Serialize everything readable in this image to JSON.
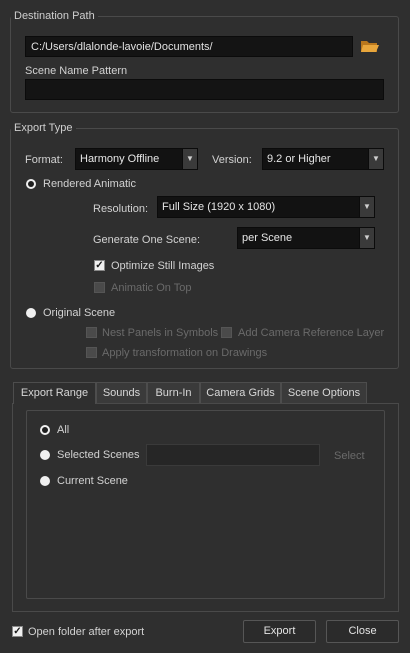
{
  "destination": {
    "title": "Destination Path",
    "path_value": "C:/Users/dlalonde-lavoie/Documents/",
    "browse_icon": "folder-icon",
    "scene_name_label": "Scene Name Pattern",
    "scene_name_value": ""
  },
  "export_type": {
    "title": "Export Type",
    "format_label": "Format:",
    "format_value": "Harmony Offline",
    "version_label": "Version:",
    "version_value": "9.2 or Higher",
    "rendered_animatic_label": "Rendered Animatic",
    "rendered_animatic_selected": true,
    "resolution_label": "Resolution:",
    "resolution_value": "Full Size (1920 x 1080)",
    "generate_scene_label": "Generate One Scene:",
    "generate_scene_value": "per Scene",
    "optimize_still_label": "Optimize Still Images",
    "optimize_still_checked": true,
    "animatic_on_top_label": "Animatic On Top",
    "animatic_on_top_checked": false,
    "original_scene_label": "Original Scene",
    "original_scene_selected": false,
    "nest_panels_label": "Nest Panels in Symbols",
    "add_camera_ref_label": "Add Camera Reference Layer",
    "apply_transform_label": "Apply transformation on Drawings"
  },
  "tabs": [
    {
      "label": "Export Range",
      "active": true
    },
    {
      "label": "Sounds",
      "active": false
    },
    {
      "label": "Burn-In",
      "active": false
    },
    {
      "label": "Camera Grids",
      "active": false
    },
    {
      "label": "Scene Options",
      "active": false
    }
  ],
  "export_range": {
    "all_label": "All",
    "all_selected": true,
    "selected_scenes_label": "Selected Scenes",
    "selected_scenes_value": "",
    "select_button_label": "Select",
    "current_scene_label": "Current Scene"
  },
  "footer": {
    "open_folder_label": "Open folder after export",
    "open_folder_checked": true,
    "export_label": "Export",
    "close_label": "Close"
  },
  "colors": {
    "background": "#2f2f2f",
    "field_background": "#141414",
    "folder_icon": "#e8a63c"
  }
}
